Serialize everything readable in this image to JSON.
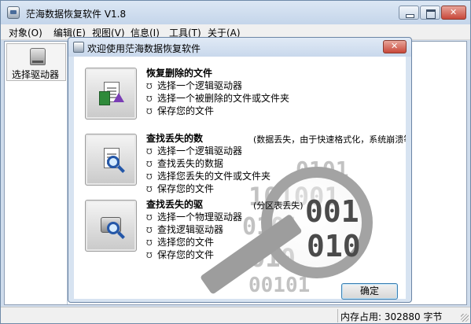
{
  "window": {
    "title": "茫海数据恢复软件 V1.8"
  },
  "menu": [
    "对象(O)",
    "编辑(E)",
    "视图(V)",
    "信息(I)",
    "工具(T)",
    "关于(A)"
  ],
  "sidebar": {
    "drive_button": "选择驱动器"
  },
  "dialog": {
    "title": "欢迎使用茫海数据恢复软件",
    "sections": [
      {
        "title": "恢复删除的文件",
        "note": "",
        "steps": [
          "选择一个逻辑驱动器",
          "选择一个被删除的文件或文件夹",
          "保存您的文件"
        ]
      },
      {
        "title": "查找丢失的数",
        "note": "(数据丢失，由于快速格式化，系统崩溃等)",
        "steps": [
          "选择一个逻辑驱动器",
          "查找丢失的数据",
          "选择您丢失的文件或文件夹",
          "保存您的文件"
        ]
      },
      {
        "title": "查找丢失的驱",
        "note": "(分区表丢失)",
        "steps": [
          "选择一个物理驱动器",
          "查找逻辑驱动器",
          "选择您的文件",
          "保存您的文件"
        ]
      }
    ],
    "bullet": "Ʊ",
    "ok_label": "确定"
  },
  "status": {
    "memory": "内存占用: 302880 字节"
  }
}
